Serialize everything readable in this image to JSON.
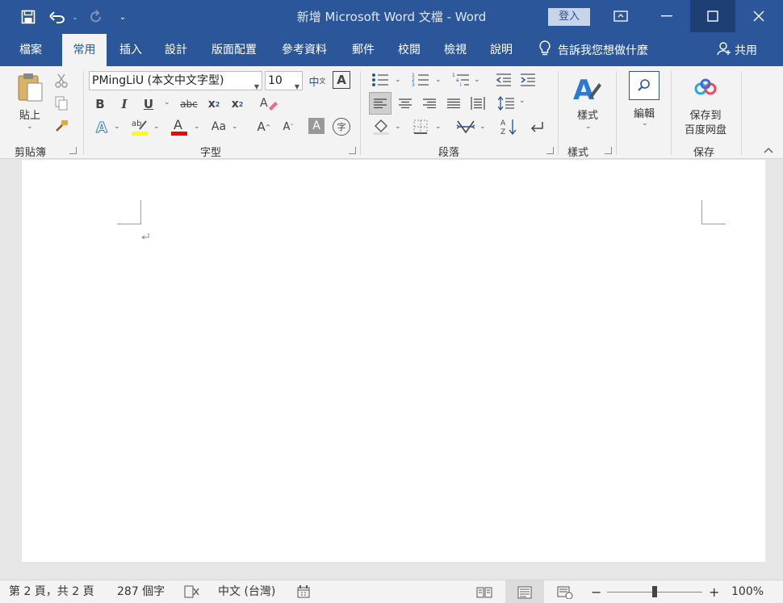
{
  "window": {
    "title": "新增 Microsoft Word 文檔  -  Word",
    "login_label": "登入"
  },
  "tabs": [
    {
      "label": "檔案",
      "active": false
    },
    {
      "label": "常用",
      "active": true
    },
    {
      "label": "插入",
      "active": false
    },
    {
      "label": "設計",
      "active": false
    },
    {
      "label": "版面配置",
      "active": false
    },
    {
      "label": "參考資料",
      "active": false
    },
    {
      "label": "郵件",
      "active": false
    },
    {
      "label": "校閱",
      "active": false
    },
    {
      "label": "檢視",
      "active": false
    },
    {
      "label": "說明",
      "active": false
    }
  ],
  "tell_me": "告訴我您想做什麼",
  "share_label": "共用",
  "ribbon": {
    "clipboard": {
      "paste_label": "貼上",
      "group_label": "剪貼簿"
    },
    "font": {
      "font_name": "PMingLiU (本文中文字型)",
      "font_size": "10",
      "group_label": "字型"
    },
    "paragraph": {
      "group_label": "段落"
    },
    "styles": {
      "styles_label": "樣式",
      "group_label": "樣式"
    },
    "editing": {
      "edit_label": "編輯"
    },
    "save": {
      "save_label_line1": "保存到",
      "save_label_line2": "百度网盘",
      "group_label": "保存"
    }
  },
  "colors": {
    "brand": "#2b579a",
    "highlight": "#ffff00",
    "font_color": "#ff0000"
  },
  "statusbar": {
    "page_info": "第 2 頁，共 2 頁",
    "word_count": "287 個字",
    "language": "中文 (台灣)",
    "zoom": "100%"
  }
}
